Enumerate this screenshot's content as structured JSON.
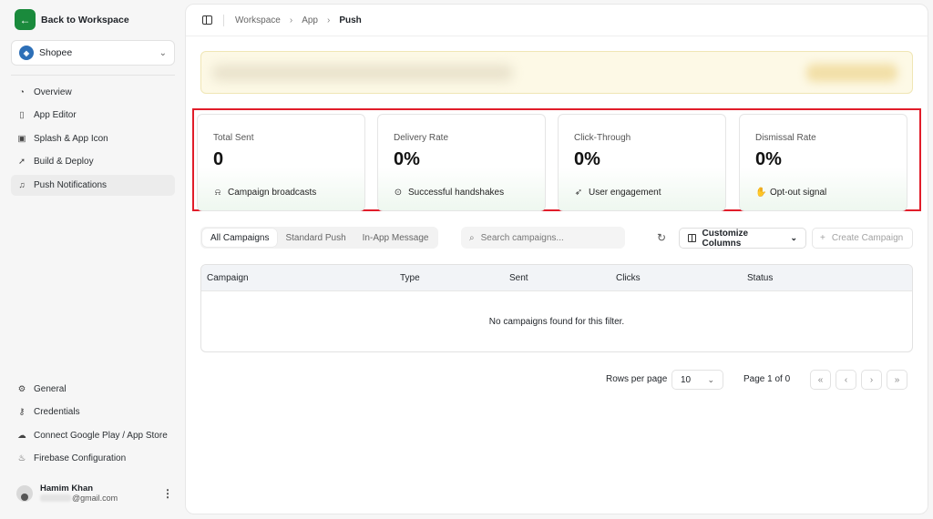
{
  "sidebar": {
    "back_label": "Back to Workspace",
    "org": {
      "name": "Shopee"
    },
    "nav": [
      {
        "label": "Overview",
        "icon": "gauge-icon"
      },
      {
        "label": "App Editor",
        "icon": "phone-icon"
      },
      {
        "label": "Splash & App Icon",
        "icon": "image-icon"
      },
      {
        "label": "Build & Deploy",
        "icon": "rocket-icon"
      },
      {
        "label": "Push Notifications",
        "icon": "bell-icon",
        "active": true
      }
    ],
    "settings": [
      {
        "label": "General",
        "icon": "gear-icon"
      },
      {
        "label": "Credentials",
        "icon": "key-icon"
      },
      {
        "label": "Connect Google Play / App Store",
        "icon": "cloud-upload-icon"
      },
      {
        "label": "Firebase Configuration",
        "icon": "flame-icon"
      }
    ],
    "user": {
      "name": "Hamim Khan",
      "email": "@gmail.com"
    }
  },
  "breadcrumb": {
    "items": [
      "Workspace",
      "App"
    ],
    "current": "Push"
  },
  "stats": [
    {
      "title": "Total Sent",
      "value": "0",
      "footer": "Campaign broadcasts",
      "icon": "bell-icon"
    },
    {
      "title": "Delivery Rate",
      "value": "0%",
      "footer": "Successful handshakes",
      "icon": "check-circle-icon"
    },
    {
      "title": "Click-Through",
      "value": "0%",
      "footer": "User engagement",
      "icon": "pointer-icon"
    },
    {
      "title": "Dismissal Rate",
      "value": "0%",
      "footer": "Opt-out signal",
      "icon": "hand-icon"
    }
  ],
  "tabs": [
    "All Campaigns",
    "Standard Push",
    "In-App Message"
  ],
  "active_tab": "All Campaigns",
  "search": {
    "placeholder": "Search campaigns..."
  },
  "toolbar": {
    "customize_label": "Customize Columns",
    "create_label": "Create Campaign"
  },
  "table": {
    "columns": [
      "Campaign",
      "Type",
      "Sent",
      "Clicks",
      "Status"
    ],
    "empty_text": "No campaigns found for this filter."
  },
  "pagination": {
    "rows_label": "Rows per page",
    "rows_value": "10",
    "page_info": "Page 1 of 0"
  },
  "colors": {
    "accent": "#1a8a3c",
    "highlight_border": "#e11d2a",
    "banner": "#fdf9e6"
  }
}
